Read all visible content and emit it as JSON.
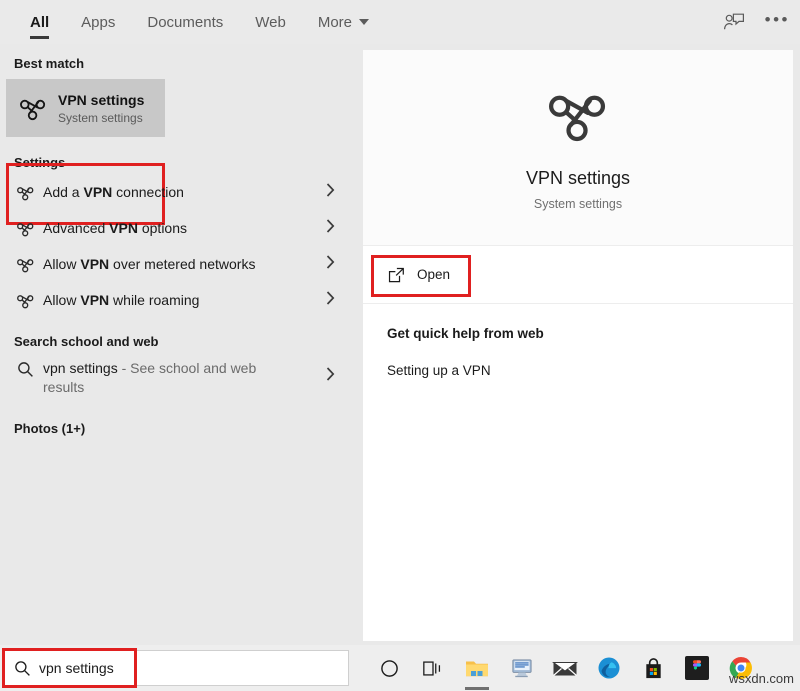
{
  "window": {
    "app": "Windows Search",
    "watermark": "wsxdn.com"
  },
  "tabbar": {
    "tabs": [
      {
        "label": "All",
        "active": true
      },
      {
        "label": "Apps",
        "active": false
      },
      {
        "label": "Documents",
        "active": false
      },
      {
        "label": "Web",
        "active": false
      },
      {
        "label": "More",
        "active": false,
        "has_caret": true
      }
    ],
    "feedback_icon": "feedback-person-icon",
    "more_icon": "ellipsis-icon"
  },
  "left_pane": {
    "best_match": {
      "header": "Best match",
      "title": "VPN settings",
      "subtitle": "System settings",
      "icon": "vpn-icon",
      "selected": true,
      "highlight_color": "#e02020"
    },
    "settings": {
      "header": "Settings",
      "items": [
        {
          "prefix": "Add a ",
          "bold": "VPN",
          "suffix": " connection",
          "icon": "vpn-icon",
          "chevron": "chevron-right-icon"
        },
        {
          "prefix": "Advanced ",
          "bold": "VPN",
          "suffix": " options",
          "icon": "vpn-icon",
          "chevron": "chevron-right-icon"
        },
        {
          "prefix": "Allow ",
          "bold": "VPN",
          "suffix": " over metered networks",
          "icon": "vpn-icon",
          "chevron": "chevron-right-icon"
        },
        {
          "prefix": "Allow ",
          "bold": "VPN",
          "suffix": " while roaming",
          "icon": "vpn-icon",
          "chevron": "chevron-right-icon"
        }
      ]
    },
    "web": {
      "header": "Search school and web",
      "query": "vpn settings",
      "description": " - See school and web results",
      "icon": "search-icon",
      "chevron": "chevron-right-icon"
    },
    "photos": {
      "header": "Photos (1+)"
    }
  },
  "right_pane": {
    "preview": {
      "icon": "vpn-icon-large",
      "title": "VPN settings",
      "subtitle": "System settings"
    },
    "open_action": {
      "label": "Open",
      "icon": "open-external-icon",
      "highlighted": true,
      "highlight_color": "#e02020"
    },
    "quick_help": {
      "title": "Get quick help from web",
      "links": [
        "Setting up a VPN"
      ]
    }
  },
  "taskbar": {
    "search": {
      "icon": "search-icon",
      "value": "vpn settings",
      "highlighted": true,
      "highlight_color": "#e02020"
    },
    "apps": [
      {
        "name": "cortana-circle-icon",
        "label": "Cortana"
      },
      {
        "name": "task-view-icon",
        "label": "Task View"
      },
      {
        "name": "file-explorer-icon",
        "label": "File Explorer",
        "running": true
      },
      {
        "name": "remote-desktop-icon",
        "label": "Remote Desktop"
      },
      {
        "name": "mail-icon",
        "label": "Mail"
      },
      {
        "name": "edge-icon",
        "label": "Microsoft Edge"
      },
      {
        "name": "microsoft-store-icon",
        "label": "Microsoft Store"
      },
      {
        "name": "figma-icon",
        "label": "Figma"
      },
      {
        "name": "chrome-icon",
        "label": "Google Chrome"
      }
    ]
  }
}
